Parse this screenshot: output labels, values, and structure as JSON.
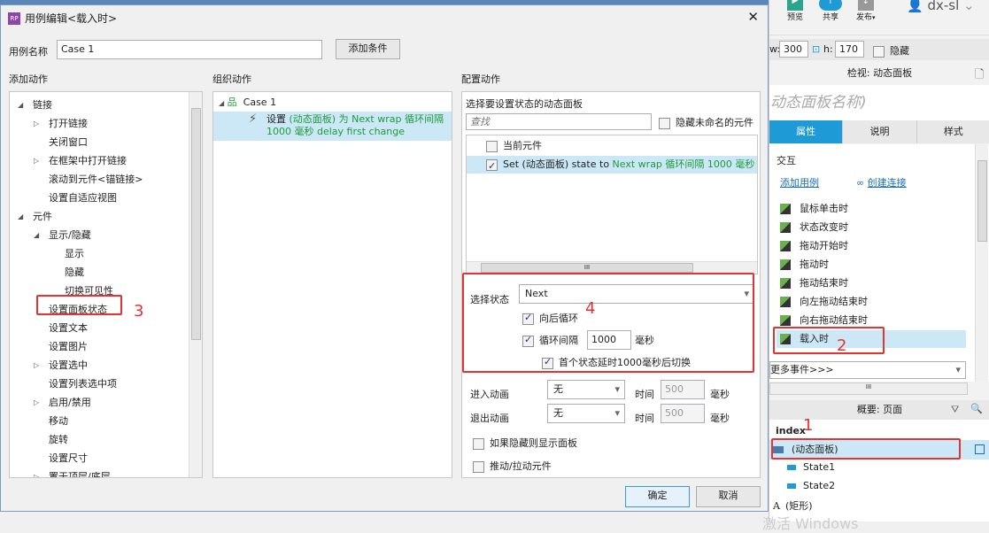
{
  "dialog": {
    "title": "用例编辑<载入时>",
    "case_name_label": "用例名称",
    "case_name_value": "Case 1",
    "add_condition": "添加条件",
    "ok": "确定",
    "cancel": "取消"
  },
  "add_actions": {
    "header": "添加动作",
    "items": [
      {
        "label": "链接",
        "level": 0,
        "expand": "open"
      },
      {
        "label": "打开链接",
        "level": 1,
        "expand": "closed"
      },
      {
        "label": "关闭窗口",
        "level": 1
      },
      {
        "label": "在框架中打开链接",
        "level": 1,
        "expand": "closed"
      },
      {
        "label": "滚动到元件<锚链接>",
        "level": 1
      },
      {
        "label": "设置自适应视图",
        "level": 1
      },
      {
        "label": "元件",
        "level": 0,
        "expand": "open"
      },
      {
        "label": "显示/隐藏",
        "level": 1,
        "expand": "open"
      },
      {
        "label": "显示",
        "level": 2
      },
      {
        "label": "隐藏",
        "level": 2
      },
      {
        "label": "切换可见性",
        "level": 2
      },
      {
        "label": "设置面板状态",
        "level": 1,
        "highlight": true
      },
      {
        "label": "设置文本",
        "level": 1
      },
      {
        "label": "设置图片",
        "level": 1
      },
      {
        "label": "设置选中",
        "level": 1,
        "expand": "closed"
      },
      {
        "label": "设置列表选中项",
        "level": 1
      },
      {
        "label": "启用/禁用",
        "level": 1,
        "expand": "closed"
      },
      {
        "label": "移动",
        "level": 1
      },
      {
        "label": "旋转",
        "level": 1
      },
      {
        "label": "设置尺寸",
        "level": 1
      },
      {
        "label": "置于顶层/底层",
        "level": 1,
        "expand": "closed"
      }
    ]
  },
  "organize": {
    "header": "组织动作",
    "case": "Case 1",
    "action_prefix": "设置 ",
    "action_green1": "(动态面板)",
    "action_mid": " 为 ",
    "action_green2": "Next wrap 循环间隔",
    "action_line2": "1000 毫秒 delay first change"
  },
  "configure": {
    "header": "配置动作",
    "select_panel_label": "选择要设置状态的动态面板",
    "search_placeholder": "查找",
    "hide_unnamed": "隐藏未命名的元件",
    "list": {
      "current": "当前元件",
      "item_prefix": "Set (动态面板) state to ",
      "item_green": "Next wrap 循环间隔 1000 毫秒 dela"
    },
    "state_label": "选择状态",
    "state_value": "Next",
    "wrap": "向后循环",
    "interval_label": "循环间隔",
    "interval_value": "1000",
    "ms": "毫秒",
    "first_delay": "首个状态延时1000毫秒后切换",
    "enter_anim": "进入动画",
    "exit_anim": "退出动画",
    "anim_value": "无",
    "time": "时间",
    "time_value": "500",
    "show_if_hidden": "如果隐藏则显示面板",
    "push_pull": "推动/拉动元件"
  },
  "annotations": {
    "n1": "1",
    "n2": "2",
    "n3": "3",
    "n4": "4"
  },
  "right_panel": {
    "preview": "预览",
    "share": "共享",
    "publish": "发布",
    "user": "dx-sl",
    "w_label": "w:",
    "w": "300",
    "h_label": "h:",
    "h": "170",
    "hidden": "隐藏",
    "inspect": "检视: 动态面板",
    "name_placeholder": "动态面板名称)",
    "tabs": [
      "属性",
      "说明",
      "样式"
    ],
    "interaction": "交互",
    "add_case": "添加用例",
    "create_link": "创建连接",
    "events": [
      "鼠标单击时",
      "状态改变时",
      "拖动开始时",
      "拖动时",
      "拖动结束时",
      "向左拖动结束时",
      "向右拖动结束时",
      "载入时"
    ],
    "more_events": "更多事件>>>",
    "outline": "概要: 页面",
    "page": "index",
    "tree": [
      "(动态面板)",
      "State1",
      "State2",
      "(矩形)"
    ],
    "watermark": "激活 Windows"
  },
  "colors": {
    "accent": "#1e9ad6",
    "highlight": "#cce8f6",
    "annotation": "#e53333",
    "green": "#1e9a3a"
  }
}
